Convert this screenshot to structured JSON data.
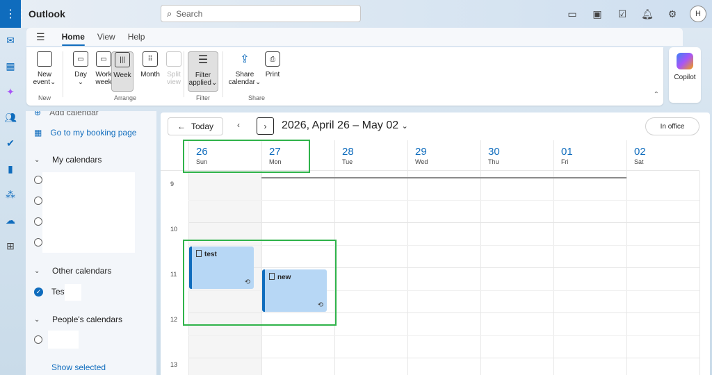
{
  "app": {
    "title": "Outlook"
  },
  "search": {
    "placeholder": "Search"
  },
  "user": {
    "initial": "H"
  },
  "ribbon_tabs": [
    {
      "label": "Home",
      "active": true
    },
    {
      "label": "View",
      "active": false
    },
    {
      "label": "Help",
      "active": false
    }
  ],
  "ribbon": {
    "new_event": {
      "line1": "New",
      "line2": "event",
      "group": "New"
    },
    "arrange": {
      "group": "Arrange",
      "day": {
        "line1": "Day",
        "line2": "⌄"
      },
      "work_week": {
        "line1": "Work",
        "line2": "week"
      },
      "week": {
        "line1": "Week"
      },
      "month": {
        "line1": "Month"
      },
      "split_view": {
        "line1": "Split",
        "line2": "view"
      }
    },
    "filter": {
      "line1": "Filter",
      "line2": "applied",
      "group": "Filter"
    },
    "share": {
      "group": "Share",
      "share_calendar": {
        "line1": "Share",
        "line2": "calendar"
      },
      "print": {
        "line1": "Print"
      }
    },
    "copilot": {
      "label": "Copilot"
    }
  },
  "left_pane": {
    "add_calendar": "Add calendar",
    "booking_page": "Go to my booking page",
    "my_calendars": "My calendars",
    "other_calendars": "Other calendars",
    "other_item": "Test",
    "peoples_calendars": "People's calendars",
    "show_selected": "Show selected"
  },
  "calendar": {
    "today_label": "Today",
    "range_title": "2026, April 26 – May 02",
    "status_label": "In office",
    "days": [
      {
        "num": "26",
        "name": "Sun"
      },
      {
        "num": "27",
        "name": "Mon"
      },
      {
        "num": "28",
        "name": "Tue"
      },
      {
        "num": "29",
        "name": "Wed"
      },
      {
        "num": "30",
        "name": "Thu"
      },
      {
        "num": "01",
        "name": "Fri"
      },
      {
        "num": "02",
        "name": "Sat"
      }
    ],
    "hours": [
      "9",
      "10",
      "11",
      "12",
      "13"
    ],
    "events": [
      {
        "title": "test",
        "day": "Sun",
        "recurring": true
      },
      {
        "title": "new",
        "day": "Mon",
        "recurring": true
      }
    ]
  },
  "colors": {
    "accent": "#0f6cbd",
    "event_fill": "#b7d7f5",
    "highlight": "#2fb34a"
  }
}
